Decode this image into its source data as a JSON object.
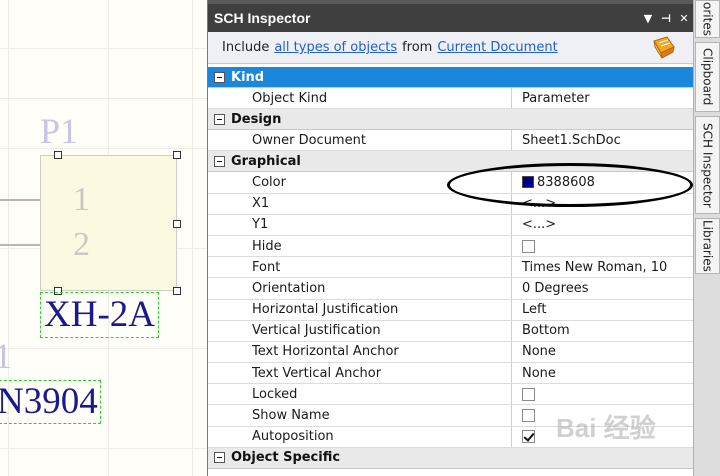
{
  "canvas": {
    "designator": "P1",
    "pins": [
      "1",
      "2"
    ],
    "comment": "XH-2A",
    "designator2": "1",
    "comment2": "N3904"
  },
  "inspector": {
    "title": "SCH Inspector",
    "title_buttons": [
      "▼",
      "⊣",
      "✕"
    ],
    "filter": {
      "prefix": "Include",
      "types_link": "all types of objects",
      "middle": "from",
      "source_link": "Current Document"
    },
    "categories": [
      {
        "label": "Kind",
        "selected": true,
        "rows": [
          {
            "name": "Object Kind",
            "value": "Parameter"
          }
        ]
      },
      {
        "label": "Design",
        "selected": false,
        "rows": [
          {
            "name": "Owner Document",
            "value": "Sheet1.SchDoc"
          }
        ]
      },
      {
        "label": "Graphical",
        "selected": false,
        "rows": [
          {
            "name": "Color",
            "value": "8388608",
            "swatch": "#000080"
          },
          {
            "name": "X1",
            "value": "<...>"
          },
          {
            "name": "Y1",
            "value": "<...>"
          },
          {
            "name": "Hide",
            "checkbox": false
          },
          {
            "name": "Font",
            "value": "Times New Roman, 10"
          },
          {
            "name": "Orientation",
            "value": "0 Degrees"
          },
          {
            "name": "Horizontal Justification",
            "value": "Left"
          },
          {
            "name": "Vertical Justification",
            "value": "Bottom"
          },
          {
            "name": "Text Horizontal Anchor",
            "value": "None"
          },
          {
            "name": "Text Vertical Anchor",
            "value": "None"
          },
          {
            "name": "Locked",
            "checkbox": false
          },
          {
            "name": "Show Name",
            "checkbox": false
          },
          {
            "name": "Autoposition",
            "checkbox": true
          }
        ]
      },
      {
        "label": "Object Specific",
        "selected": false,
        "rows": []
      }
    ]
  },
  "side_tabs": [
    "orites",
    "Clipboard",
    "SCH Inspector",
    "Libraries"
  ],
  "watermark": "Bai 经验"
}
